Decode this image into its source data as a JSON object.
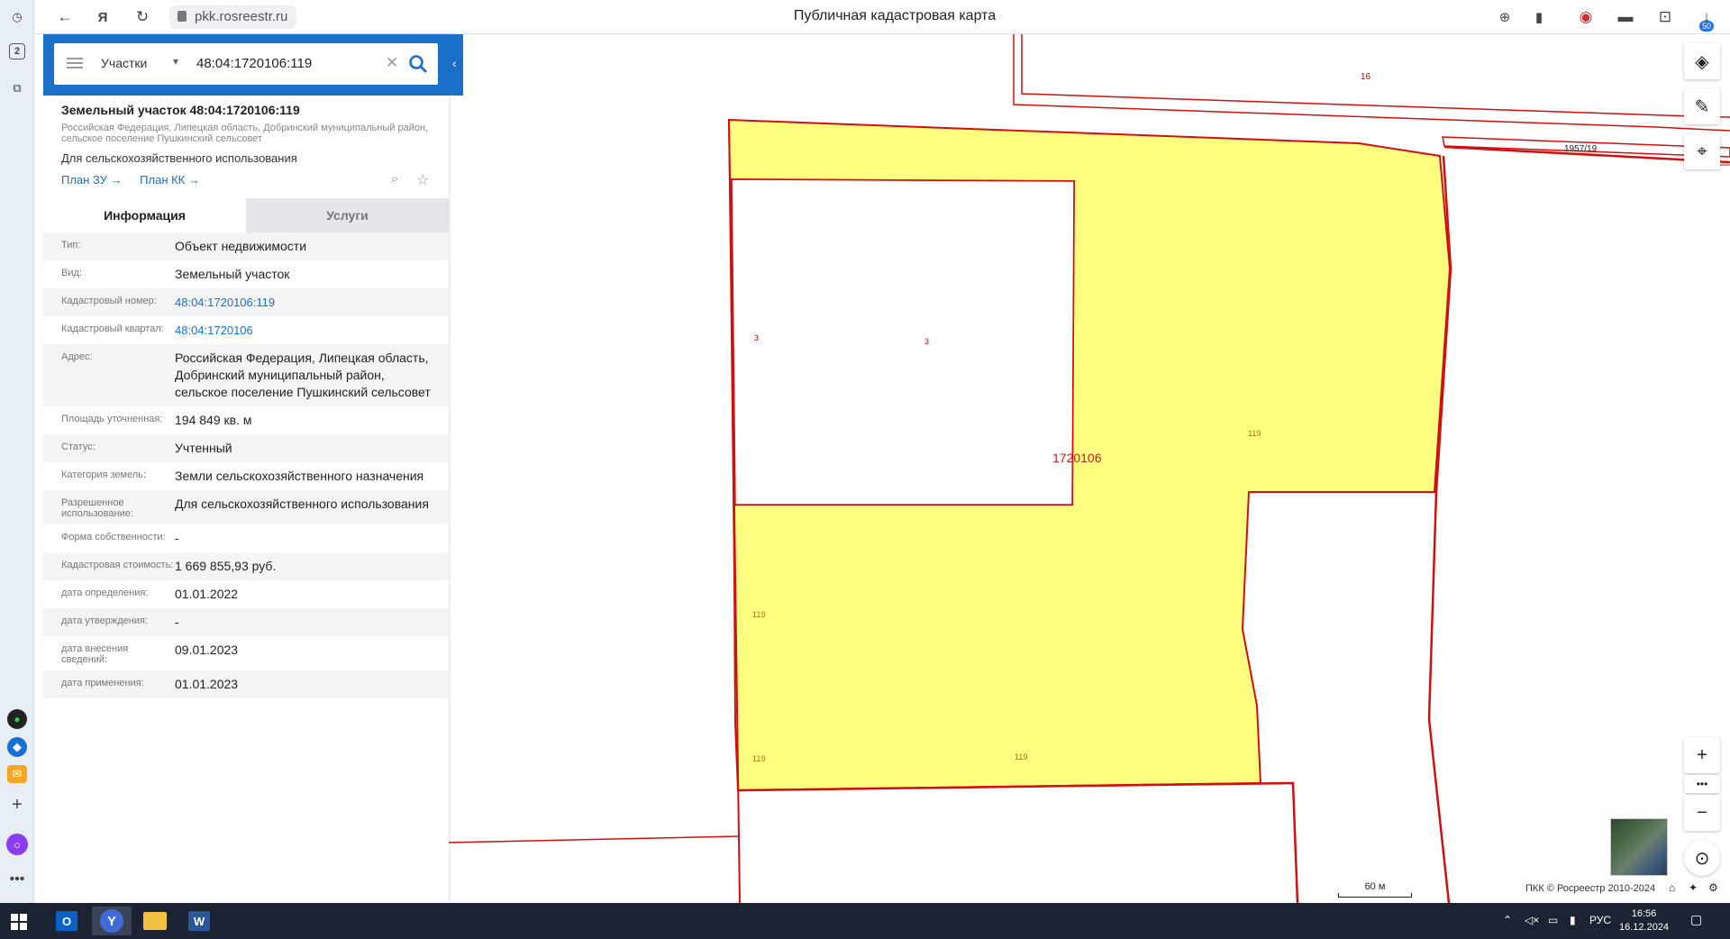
{
  "browser": {
    "url": "pkk.rosreestr.ru",
    "page_title": "Публичная кадастровая карта",
    "sidebar_badge": "2",
    "downloads_badge": "50"
  },
  "search": {
    "category": "Участки",
    "value": "48:04:1720106:119"
  },
  "object": {
    "title": "Земельный участок 48:04:1720106:119",
    "address_short": "Российская Федерация, Липецкая область, Добринский муниципальный район, сельское поселение Пушкинский сельсовет",
    "purpose": "Для сельскохозяйственного использования",
    "link_zu": "План ЗУ →",
    "link_kk": "План КК →"
  },
  "tabs": {
    "info": "Информация",
    "services": "Услуги"
  },
  "rows": [
    {
      "label": "Тип:",
      "value": "Объект недвижимости"
    },
    {
      "label": "Вид:",
      "value": "Земельный участок"
    },
    {
      "label": "Кадастровый номер:",
      "value": "48:04:1720106:119"
    },
    {
      "label": "Кадастровый квартал:",
      "value": "48:04:1720106"
    },
    {
      "label": "Адрес:",
      "value": "Российская Федерация, Липецкая область, Добринский муниципальный район, сельское поселение Пушкинский сельсовет"
    },
    {
      "label": "Площадь уточненная:",
      "value": "194 849 кв. м"
    },
    {
      "label": "Статус:",
      "value": "Учтенный"
    },
    {
      "label": "Категория земель:",
      "value": "Земли сельскохозяйственного назначения"
    },
    {
      "label": "Разрешенное использование:",
      "value": "Для сельскохозяйственного использования"
    },
    {
      "label": "Форма собственности:",
      "value": "-"
    },
    {
      "label": "Кадастровая стоимость:",
      "value": "1 669 855,93 руб."
    },
    {
      "label": "дата определения:",
      "value": "01.01.2022"
    },
    {
      "label": "дата утверждения:",
      "value": "-"
    },
    {
      "label": "дата внесения сведений:",
      "value": "09.01.2023"
    },
    {
      "label": "дата применения:",
      "value": "01.01.2023"
    }
  ],
  "map": {
    "labels": {
      "parcel_16": "16",
      "parcel_1957": "1957/19",
      "quarter": "1720106",
      "n3a": "3",
      "n3b": "3",
      "n119a": "119",
      "n119b": "119",
      "n119c": "119",
      "n119d": "119"
    },
    "parcel_fill": "#ffff80",
    "boundary_color": "#d01010",
    "scale_label": "60 м",
    "attribution": "ПКК © Росреестр 2010-2024"
  },
  "taskbar": {
    "lang": "РУС",
    "time": "16:56",
    "date": "16.12.2024"
  }
}
